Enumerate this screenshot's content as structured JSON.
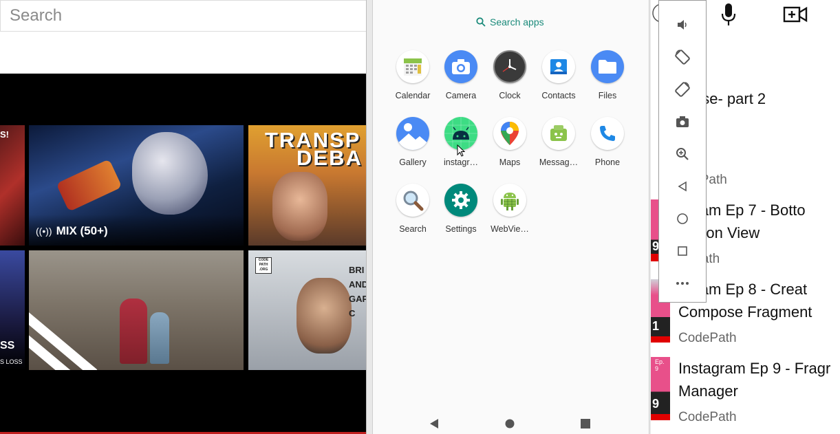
{
  "browser": {
    "search_placeholder": "Search",
    "mix_label": "MIX (50+)",
    "mix_icon": "radio-broadcast-icon",
    "thumb3_title": "TRANSP",
    "thumb3_subtitle": "DEBA",
    "thumb1_text": "S!",
    "thumb4_text": "SS",
    "thumb4_subtext": "S LOSS",
    "thumb6_badge": "CODE PATH .ORG",
    "thumb6_text": [
      "BRI",
      "AND",
      "GAPS",
      "C"
    ]
  },
  "launcher": {
    "search_label": "Search apps",
    "apps": [
      {
        "label": "Calendar",
        "icon": "calendar-icon"
      },
      {
        "label": "Camera",
        "icon": "camera-icon"
      },
      {
        "label": "Clock",
        "icon": "clock-icon"
      },
      {
        "label": "Contacts",
        "icon": "contacts-icon"
      },
      {
        "label": "Files",
        "icon": "folder-icon"
      },
      {
        "label": "Gallery",
        "icon": "gallery-icon"
      },
      {
        "label": "instagr…",
        "icon": "android-icon"
      },
      {
        "label": "Maps",
        "icon": "maps-pin-icon"
      },
      {
        "label": "Messag…",
        "icon": "messages-icon"
      },
      {
        "label": "Phone",
        "icon": "phone-icon"
      },
      {
        "label": "Search",
        "icon": "magnifier-icon"
      },
      {
        "label": "Settings",
        "icon": "settings-gear-icon"
      },
      {
        "label": "WebVie…",
        "icon": "webview-android-icon"
      }
    ],
    "nav": [
      "back-icon",
      "home-icon",
      "recents-icon"
    ]
  },
  "emulator_toolbar": {
    "buttons": [
      "volume-icon",
      "rotate-left-icon",
      "rotate-right-icon",
      "screenshot-camera-icon",
      "zoom-icon",
      "back-triangle-icon",
      "home-circle-icon",
      "overview-square-icon",
      "more-dots-icon"
    ]
  },
  "playlist": {
    "top_icons": [
      "microphone-icon",
      "add-video-icon"
    ],
    "items": [
      {
        "title_lines": [
          "Parse- part 2"
        ],
        "channel": "odePath"
      },
      {
        "title_lines": [
          "agram Ep 7 - Botto",
          "igation View"
        ],
        "channel": "dePath",
        "thumb_num": "9"
      },
      {
        "title_lines": [
          "agram Ep 8 - Creat",
          "Compose Fragment"
        ],
        "channel": "CodePath",
        "thumb_num": "1"
      },
      {
        "title_lines": [
          "Instagram Ep 9 - Fragr",
          "Manager"
        ],
        "channel": "CodePath",
        "thumb_num": "9",
        "thumb_ep": "Ep. 9"
      }
    ]
  },
  "colors": {
    "teal": "#1a8a7a",
    "youtube_red": "#e00000",
    "thumb_pink": "#e8508a"
  }
}
